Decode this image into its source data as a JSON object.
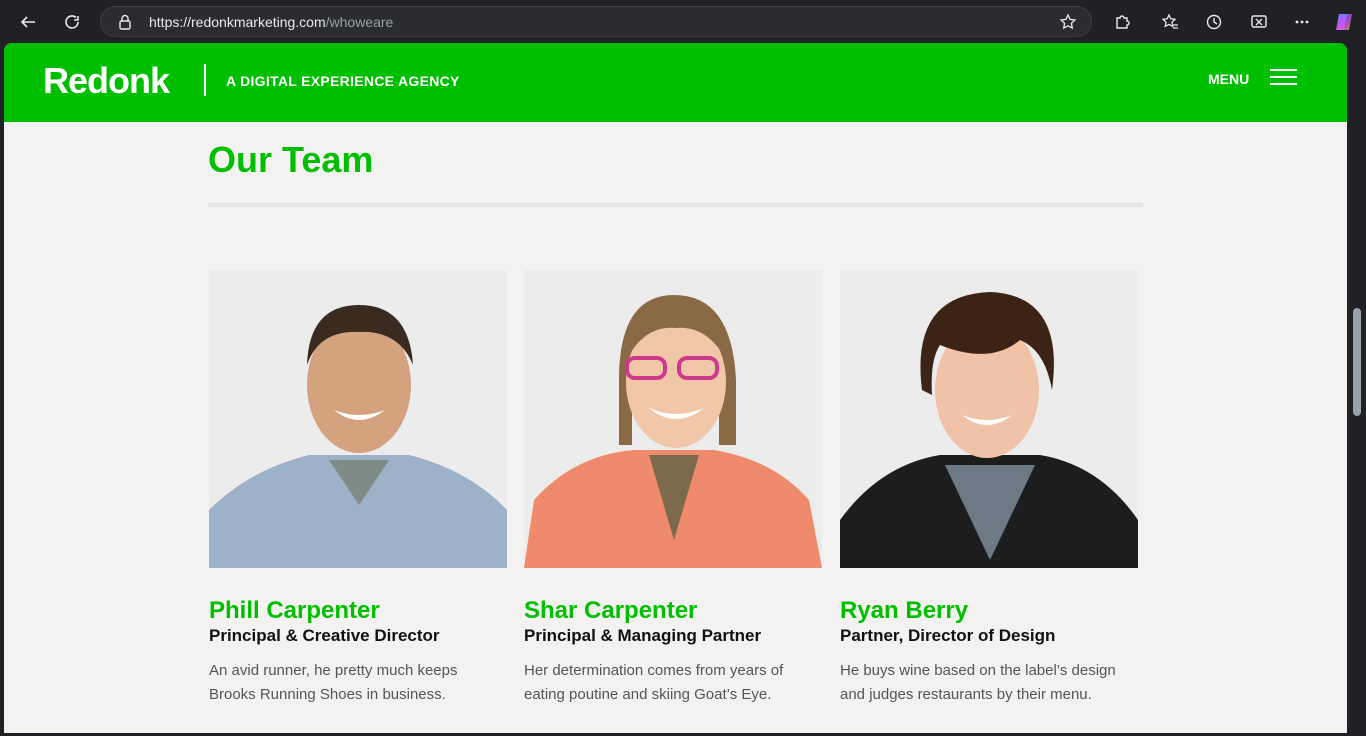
{
  "browser": {
    "url_host": "https://redonkmarketing.com",
    "url_path": "/whoweare"
  },
  "site": {
    "logo": "Redonk",
    "tagline": "A DIGITAL EXPERIENCE AGENCY",
    "menu_label": "MENU",
    "brand_color": "#00bf00"
  },
  "section": {
    "title": "Our Team"
  },
  "team": [
    {
      "name": "Phill Carpenter",
      "role": "Principal & Creative Director",
      "bio": "An avid runner, he pretty much keeps Brooks Running Shoes in business."
    },
    {
      "name": "Shar Carpenter",
      "role": "Principal & Managing Partner",
      "bio": "Her determination comes from years of eating poutine and skiing Goat’s Eye."
    },
    {
      "name": "Ryan Berry",
      "role": "Partner, Director of Design",
      "bio": "He buys wine based on the label’s design and judges restaurants by their menu."
    }
  ]
}
